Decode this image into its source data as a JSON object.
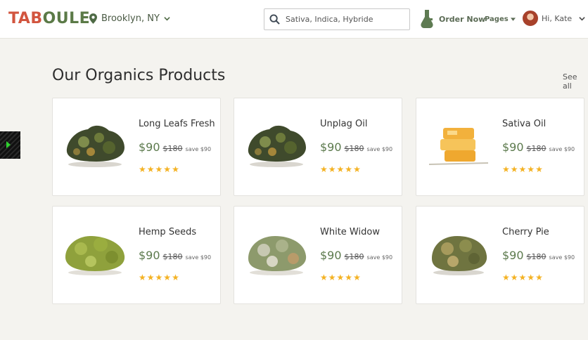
{
  "brand": {
    "part1": "TAB",
    "part2": "OULE"
  },
  "location": {
    "label": "Brooklyn, NY"
  },
  "search": {
    "placeholder": "Sativa, Indica, Hybride"
  },
  "nav": {
    "order_label": "Order Now",
    "pages_label": "Pages"
  },
  "user": {
    "greeting": "Hi, Kate"
  },
  "section": {
    "title": "Our Organics Products",
    "see_all": "See all"
  },
  "colors": {
    "brand_red": "#d2553f",
    "brand_green": "#5b7a47",
    "price_green": "#5c7a4d",
    "star": "#f4b223"
  },
  "products": [
    {
      "name": "Long Leafs Fresh",
      "price": "$90",
      "old_price": "$180",
      "save": "save $90",
      "rating": 5,
      "kind": "bud-dark"
    },
    {
      "name": "Unplag Oil",
      "price": "$90",
      "old_price": "$180",
      "save": "save $90",
      "rating": 5,
      "kind": "bud-dark"
    },
    {
      "name": "Sativa Oil",
      "price": "$90",
      "old_price": "$180",
      "save": "save $90",
      "rating": 5,
      "kind": "wax"
    },
    {
      "name": "Hemp Seeds",
      "price": "$90",
      "old_price": "$180",
      "save": "save $90",
      "rating": 5,
      "kind": "bud-light"
    },
    {
      "name": "White Widow",
      "price": "$90",
      "old_price": "$180",
      "save": "save $90",
      "rating": 5,
      "kind": "bud-frost"
    },
    {
      "name": "Cherry Pie",
      "price": "$90",
      "old_price": "$180",
      "save": "save $90",
      "rating": 5,
      "kind": "bud-olive"
    }
  ]
}
